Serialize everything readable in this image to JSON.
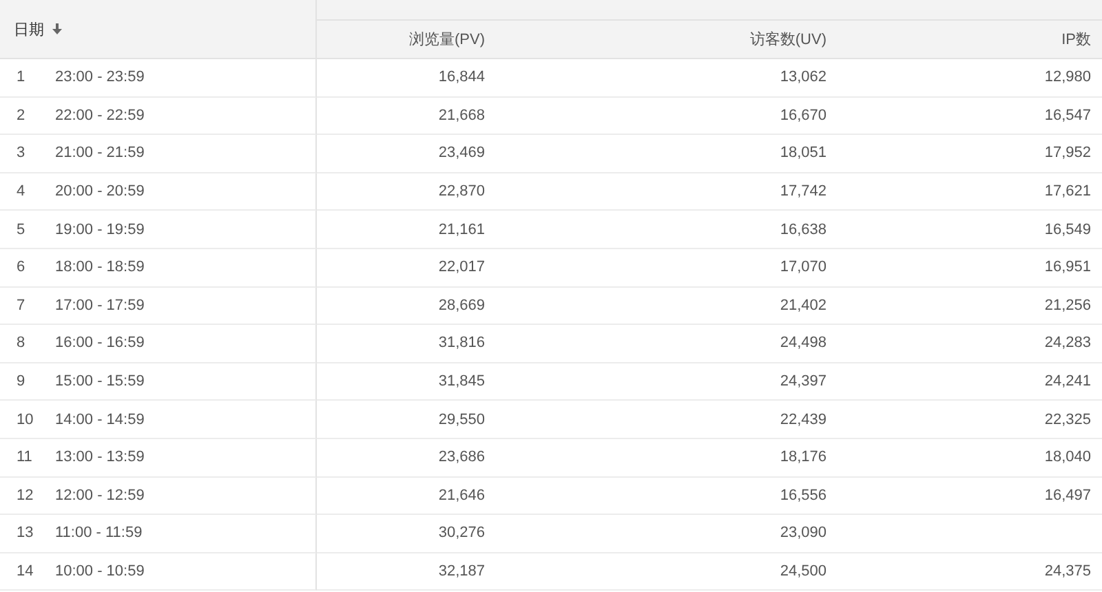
{
  "table": {
    "columns": [
      {
        "label": "日期",
        "sorted": true
      },
      {
        "label": "浏览量(PV)",
        "sorted": false
      },
      {
        "label": "访客数(UV)",
        "sorted": false
      },
      {
        "label": "IP数",
        "sorted": false
      }
    ],
    "rows": [
      {
        "index": "1",
        "time": "23:00 - 23:59",
        "pv": "16,844",
        "uv": "13,062",
        "ip": "12,980"
      },
      {
        "index": "2",
        "time": "22:00 - 22:59",
        "pv": "21,668",
        "uv": "16,670",
        "ip": "16,547"
      },
      {
        "index": "3",
        "time": "21:00 - 21:59",
        "pv": "23,469",
        "uv": "18,051",
        "ip": "17,952"
      },
      {
        "index": "4",
        "time": "20:00 - 20:59",
        "pv": "22,870",
        "uv": "17,742",
        "ip": "17,621"
      },
      {
        "index": "5",
        "time": "19:00 - 19:59",
        "pv": "21,161",
        "uv": "16,638",
        "ip": "16,549"
      },
      {
        "index": "6",
        "time": "18:00 - 18:59",
        "pv": "22,017",
        "uv": "17,070",
        "ip": "16,951"
      },
      {
        "index": "7",
        "time": "17:00 - 17:59",
        "pv": "28,669",
        "uv": "21,402",
        "ip": "21,256"
      },
      {
        "index": "8",
        "time": "16:00 - 16:59",
        "pv": "31,816",
        "uv": "24,498",
        "ip": "24,283"
      },
      {
        "index": "9",
        "time": "15:00 - 15:59",
        "pv": "31,845",
        "uv": "24,397",
        "ip": "24,241"
      },
      {
        "index": "10",
        "time": "14:00 - 14:59",
        "pv": "29,550",
        "uv": "22,439",
        "ip": "22,325"
      },
      {
        "index": "11",
        "time": "13:00 - 13:59",
        "pv": "23,686",
        "uv": "18,176",
        "ip": "18,040"
      },
      {
        "index": "12",
        "time": "12:00 - 12:59",
        "pv": "21,646",
        "uv": "16,556",
        "ip": "16,497"
      },
      {
        "index": "13",
        "time": "11:00 - 11:59",
        "pv": "30,276",
        "uv": "23,090"
      },
      {
        "index": "14",
        "time": "10:00 - 10:59",
        "pv": "32,187",
        "uv": "24,500",
        "ip": "24,375"
      }
    ]
  }
}
